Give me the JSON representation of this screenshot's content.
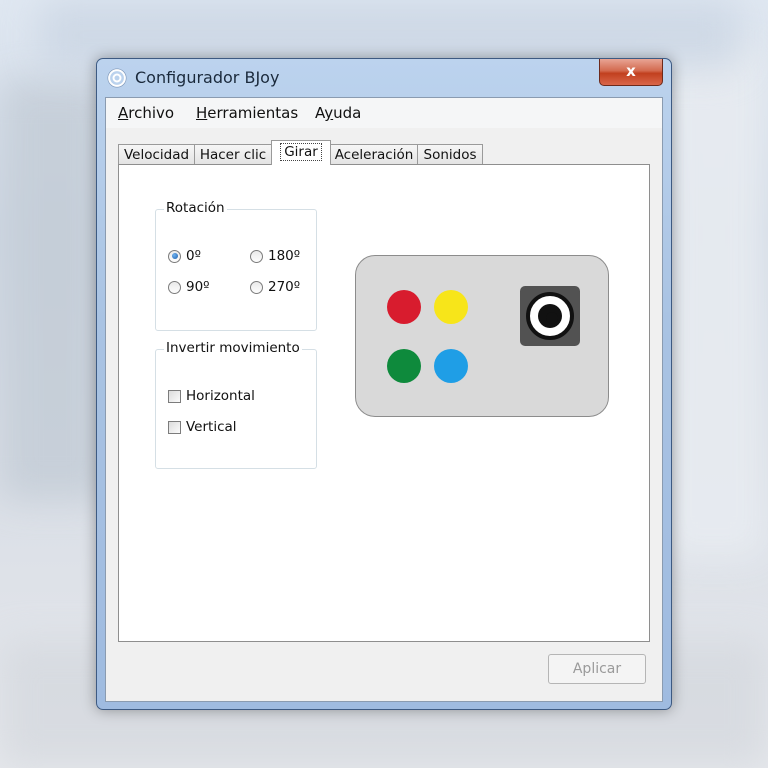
{
  "window": {
    "title": "Configurador BJoy",
    "close_glyph": "x"
  },
  "menu": [
    {
      "label": "Archivo",
      "mnemonic": "A",
      "rest": "rchivo"
    },
    {
      "label": "Herramientas",
      "mnemonic": "H",
      "rest": "erramientas"
    },
    {
      "label": "Ayuda",
      "pre": "A",
      "mnemonic": "y",
      "rest": "uda"
    }
  ],
  "tabs": [
    {
      "label": "Velocidad",
      "active": false
    },
    {
      "label": "Hacer clic",
      "active": false
    },
    {
      "label": "Girar",
      "active": true
    },
    {
      "label": "Aceleración",
      "active": false
    },
    {
      "label": "Sonidos",
      "active": false
    }
  ],
  "rotation": {
    "title": "Rotación",
    "options": [
      {
        "label": "0º",
        "selected": true
      },
      {
        "label": "180º",
        "selected": false
      },
      {
        "label": "90º",
        "selected": false
      },
      {
        "label": "270º",
        "selected": false
      }
    ]
  },
  "invert": {
    "title": "Invertir movimiento",
    "options": [
      {
        "label": "Horizontal",
        "checked": false
      },
      {
        "label": "Vertical",
        "checked": false
      }
    ]
  },
  "device": {
    "buttons": [
      {
        "name": "red-button",
        "color": "#d81c2e"
      },
      {
        "name": "yellow-button",
        "color": "#f7e51a"
      },
      {
        "name": "green-button",
        "color": "#0e8a3c"
      },
      {
        "name": "blue-button",
        "color": "#1f9ee6"
      }
    ],
    "icon": "speaker-icon"
  },
  "footer": {
    "apply_label": "Aplicar",
    "apply_enabled": false
  }
}
